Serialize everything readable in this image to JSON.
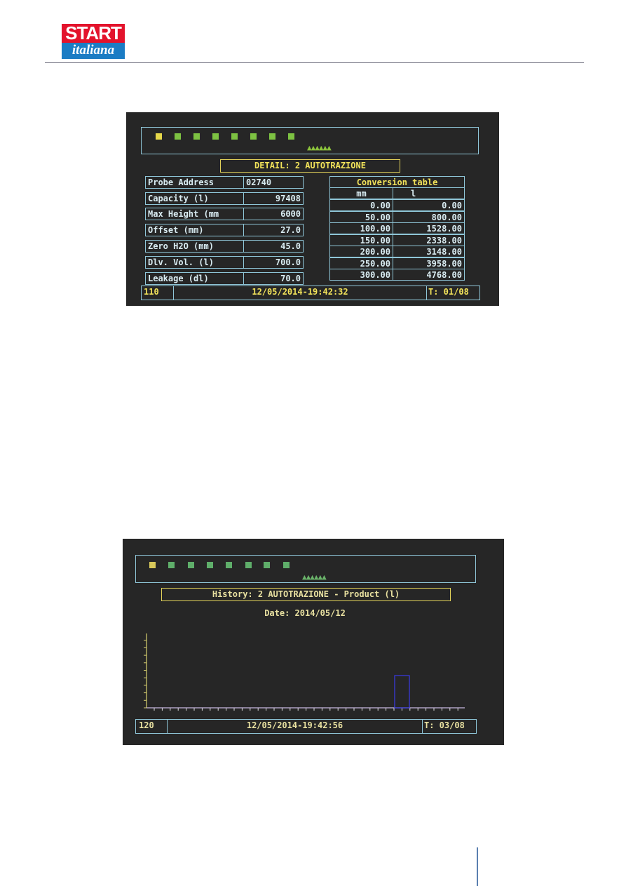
{
  "logo": {
    "line1": "START",
    "line2": "italiana"
  },
  "screen1": {
    "title": "DETAIL: 2 AUTOTRAZIONE",
    "params": [
      {
        "label": "Probe Address",
        "value": "02740"
      },
      {
        "label": "Capacity   (l)",
        "value": "97408"
      },
      {
        "label": "Max Height   (mm",
        "value": "6000"
      },
      {
        "label": "Offset   (mm)",
        "value": "27.0"
      },
      {
        "label": "Zero H2O   (mm)",
        "value": "45.0"
      },
      {
        "label": "Dlv. Vol.   (l)",
        "value": "700.0"
      },
      {
        "label": "Leakage   (dl)",
        "value": "70.0"
      }
    ],
    "conversion": {
      "title": "Conversion table",
      "col_mm": "mm",
      "col_l": "l",
      "rows": [
        [
          "0.00",
          "0.00"
        ],
        [
          "50.00",
          "800.00"
        ],
        [
          "100.00",
          "1528.00"
        ],
        [
          "150.00",
          "2338.00"
        ],
        [
          "200.00",
          "3148.00"
        ],
        [
          "250.00",
          "3958.00"
        ],
        [
          "300.00",
          "4768.00"
        ]
      ]
    },
    "status": {
      "code": "110",
      "datetime": "12/05/2014-19:42:32",
      "tank": "T: 01/08"
    }
  },
  "screen2": {
    "title": "History: 2 AUTOTRAZIONE - Product   (l)",
    "date": "Date: 2014/05/12",
    "status": {
      "code": "120",
      "datetime": "12/05/2014-19:42:56",
      "tank": "T: 03/08"
    }
  },
  "colors": {
    "screen_bg": "#262626",
    "frame": "#8fc6d8",
    "title_yellow": "#f2e35a",
    "indicator_green": "#7dc242",
    "indicator_yellow": "#e6d84a",
    "bar": "#3a3ad8"
  },
  "icons": {
    "tank_indicators": "square",
    "level_markers": "triangle-up"
  }
}
